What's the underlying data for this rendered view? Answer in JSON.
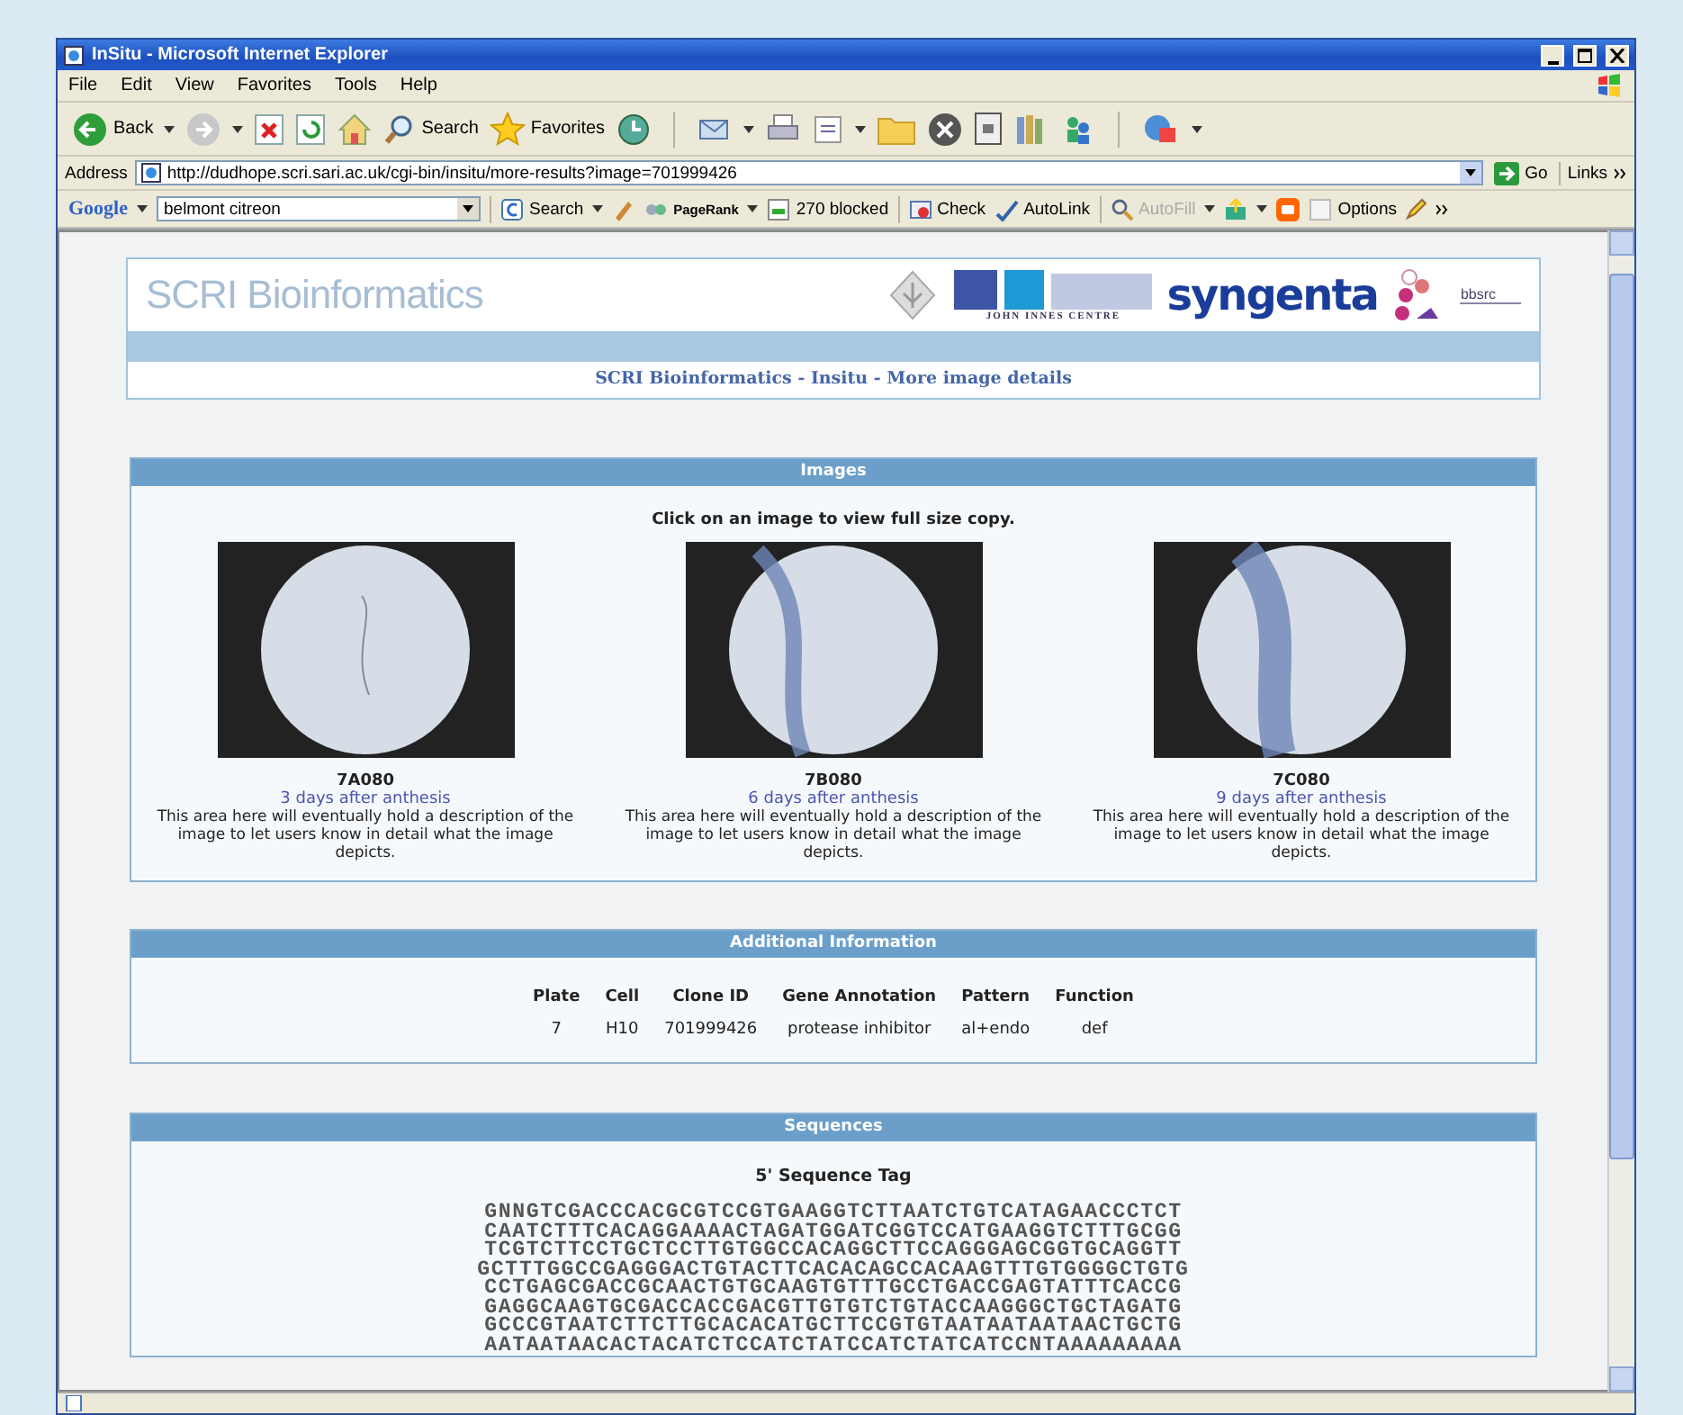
{
  "window": {
    "title": "InSitu - Microsoft Internet Explorer"
  },
  "menu": [
    "File",
    "Edit",
    "View",
    "Favorites",
    "Tools",
    "Help"
  ],
  "toolbar": {
    "back": "Back",
    "search": "Search",
    "favorites": "Favorites"
  },
  "address_bar": {
    "label": "Address",
    "url": "http://dudhope.scri.sari.ac.uk/cgi-bin/insitu/more-results?image=701999426",
    "go": "Go",
    "links": "Links"
  },
  "google_bar": {
    "logo": "Google",
    "query": "belmont citreon",
    "buttons": [
      {
        "label": "Search",
        "disabled": false
      },
      {
        "label": "PageRank",
        "disabled": false
      },
      {
        "label": "270 blocked",
        "disabled": false
      },
      {
        "label": "Check",
        "disabled": false
      },
      {
        "label": "AutoLink",
        "disabled": false
      },
      {
        "label": "AutoFill",
        "disabled": true
      },
      {
        "label": "Options",
        "disabled": false
      }
    ]
  },
  "page": {
    "header": {
      "site_title": "SCRI Bioinformatics",
      "logos": [
        "JOHN INNES CENTRE",
        "syngenta",
        "bbsrc"
      ],
      "breadcrumb": "SCRI Bioinformatics - Insitu - More image details"
    },
    "images_section": {
      "title": "Images",
      "instruction": "Click on an image to view full size copy.",
      "images": [
        {
          "name": "7A080",
          "stage": "3 days after anthesis",
          "description": "This area here will eventually hold a description of the image to let users know in detail what the image depicts."
        },
        {
          "name": "7B080",
          "stage": "6 days after anthesis",
          "description": "This area here will eventually hold a description of the image to let users know in detail what the image depicts."
        },
        {
          "name": "7C080",
          "stage": "9 days after anthesis",
          "description": "This area here will eventually hold a description of the image to let users know in detail what the image depicts."
        }
      ]
    },
    "additional_info": {
      "title": "Additional Information",
      "columns": [
        "Plate",
        "Cell",
        "Clone ID",
        "Gene Annotation",
        "Pattern",
        "Function"
      ],
      "rows": [
        [
          "7",
          "H10",
          "701999426",
          "protease inhibitor",
          "al+endo",
          "def"
        ]
      ]
    },
    "sequences": {
      "title": "Sequences",
      "subtitle": "5' Sequence Tag",
      "lines": [
        "GNNGTCGACCCACGCGTCCGTGAAGGTCTTAATCTGTCATAGAACCCTCT",
        "CAATCTTTCACAGGAAAACTAGATGGATCGGTCCATGAAGGTCTTTGCGG",
        "TCGTCTTCCTGCTCCTTGTGGCCACAGGCTTCCAGGGAGCGGTGCAGGTT",
        "GCTTTGGCCGAGGGACTGTACTTCACACAGCCACAAGTTTGTGGGGCTGTG",
        "CCTGAGCGACCGCAACTGTGCAAGTGTTTGCCTGACCGAGTATTTCACCG",
        "GAGGCAAGTGCGACCACCGACGTTGTGTCTGTACCAAGGGCTGCTAGATG",
        "GCCCGTAATCTTCTTGCACACATGCTTCCGTGTAATAATAATAACTGCTG",
        "AATAATAACACTACATCTCCATCTATCCATCTATCATCCNTAAAAAAAAA"
      ]
    }
  }
}
